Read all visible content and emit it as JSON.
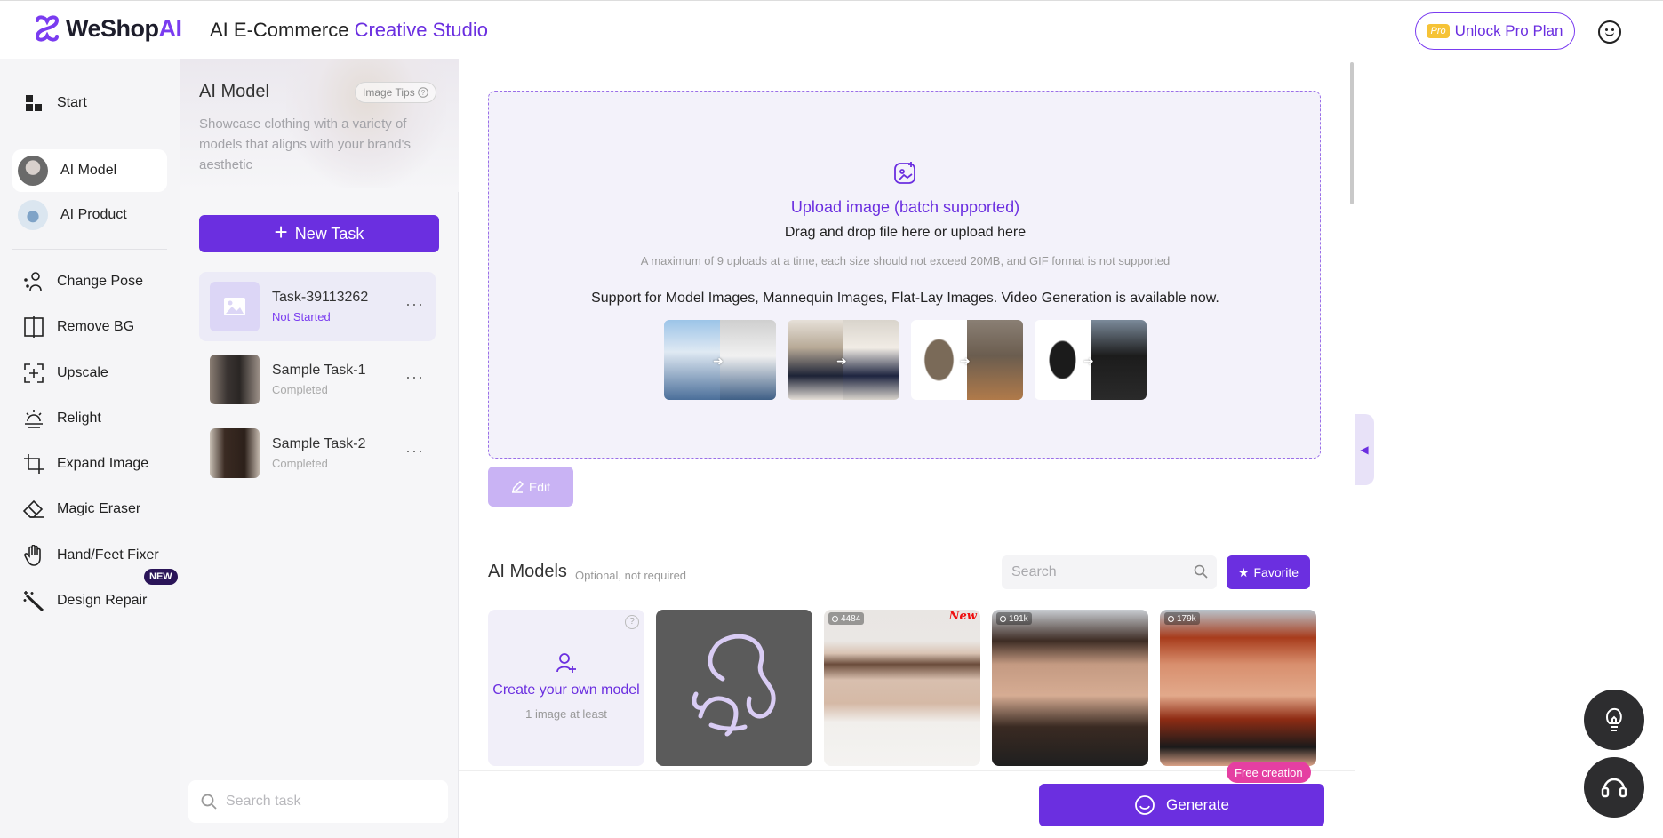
{
  "header": {
    "logo_name": "WeShop",
    "logo_ai": "AI",
    "title_prefix": "AI E-Commerce ",
    "title_accent": "Creative Studio",
    "pro_badge": "Pro",
    "pro_label": "Unlock Pro Plan"
  },
  "sidebar": {
    "items": [
      {
        "label": "Start",
        "icon": "grid-icon"
      },
      {
        "label": "AI Model",
        "icon": "model-avatar"
      },
      {
        "label": "AI Product",
        "icon": "product-avatar"
      },
      {
        "label": "Change Pose",
        "icon": "pose-icon"
      },
      {
        "label": "Remove BG",
        "icon": "remove-bg-icon"
      },
      {
        "label": "Upscale",
        "icon": "upscale-icon"
      },
      {
        "label": "Relight",
        "icon": "relight-icon"
      },
      {
        "label": "Expand Image",
        "icon": "crop-icon"
      },
      {
        "label": "Magic Eraser",
        "icon": "eraser-icon"
      },
      {
        "label": "Hand/Feet Fixer",
        "icon": "hand-icon"
      },
      {
        "label": "Design Repair",
        "icon": "wand-icon"
      }
    ],
    "new_badge": "NEW"
  },
  "task_panel": {
    "title": "AI Model",
    "tips_label": "Image Tips",
    "description": "Showcase clothing with a variety of models that aligns with your brand's aesthetic",
    "new_task_label": "New Task",
    "more": "···",
    "tasks": [
      {
        "name": "Task-39113262",
        "status": "Not Started"
      },
      {
        "name": "Sample Task-1",
        "status": "Completed"
      },
      {
        "name": "Sample Task-2",
        "status": "Completed"
      }
    ],
    "search_placeholder": "Search task"
  },
  "upload": {
    "title": "Upload image (batch supported)",
    "subtitle": "Drag and drop file here or upload here",
    "hint": "A maximum of 9 uploads at a time, each size should not exceed 20MB, and GIF format is not supported",
    "support": "Support for Model Images, Mannequin Images, Flat-Lay Images. Video Generation is available now.",
    "edit_label": "Edit"
  },
  "models": {
    "title": "AI Models",
    "optional": "Optional, not required",
    "search_placeholder": "Search",
    "favorite_label": "Favorite",
    "create_title": "Create your own model",
    "create_sub": "1 image at least",
    "help": "?",
    "cards": [
      {
        "count": "4484",
        "new": "New"
      },
      {
        "count": "191k"
      },
      {
        "count": "179k"
      }
    ]
  },
  "footer": {
    "generate_label": "Generate",
    "free_badge": "Free creation"
  },
  "colors": {
    "accent": "#6b2fe0",
    "accent_light": "#c9b3f4",
    "badge_pink": "#e53fa2"
  }
}
